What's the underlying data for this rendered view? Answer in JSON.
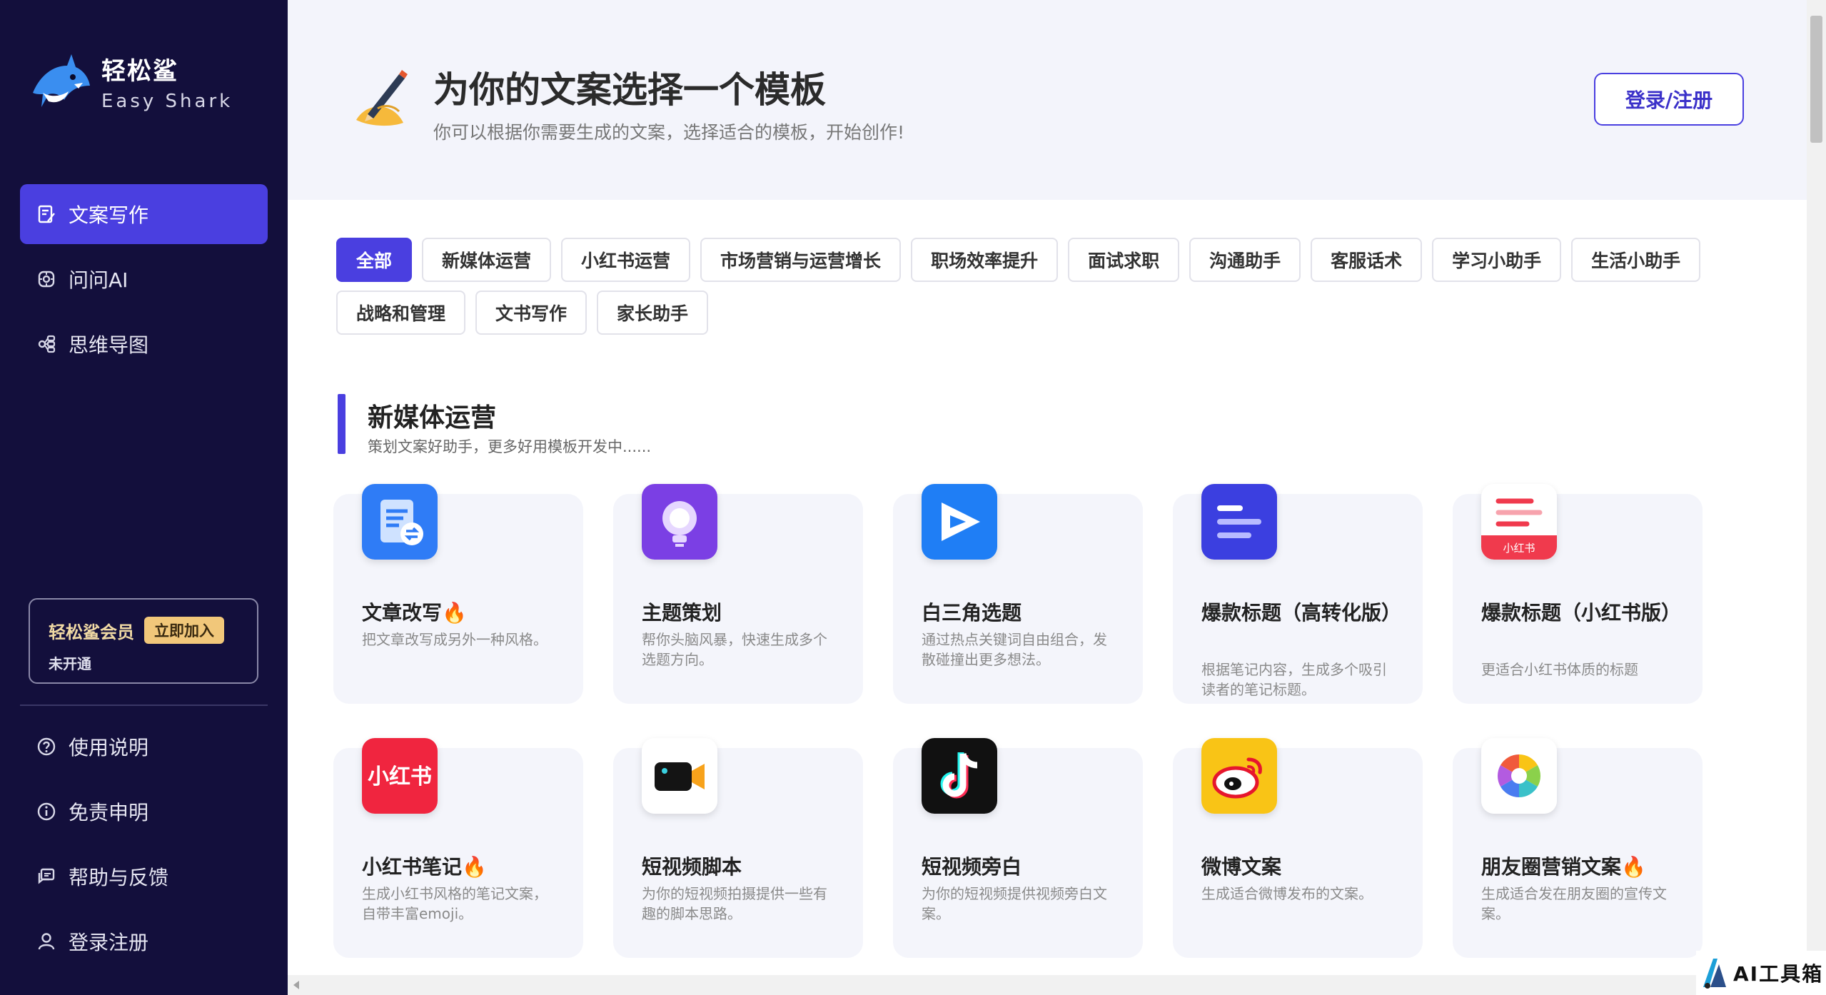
{
  "brand": {
    "name_cn": "轻松鲨",
    "name_en": "Easy Shark"
  },
  "sidebar": {
    "top_items": [
      {
        "label": "文案写作",
        "icon": "edit-doc-icon",
        "active": true
      },
      {
        "label": "问问AI",
        "icon": "ai-chat-icon",
        "active": false
      },
      {
        "label": "思维导图",
        "icon": "mindmap-icon",
        "active": false
      }
    ],
    "member": {
      "title": "轻松鲨会员",
      "join_label": "立即加入",
      "status": "未开通"
    },
    "bottom_items": [
      {
        "label": "使用说明",
        "icon": "help-circle-icon"
      },
      {
        "label": "免责申明",
        "icon": "info-circle-icon"
      },
      {
        "label": "帮助与反馈",
        "icon": "feedback-icon"
      },
      {
        "label": "登录注册",
        "icon": "user-icon"
      }
    ]
  },
  "header": {
    "emoji": "✍",
    "title": "为你的文案选择一个模板",
    "subtitle": "你可以根据你需要生成的文案，选择适合的模板，开始创作!",
    "login_label": "登录/注册"
  },
  "tabs": [
    "全部",
    "新媒体运营",
    "小红书运营",
    "市场营销与运营增长",
    "职场效率提升",
    "面试求职",
    "沟通助手",
    "客服话术",
    "学习小助手",
    "生活小助手",
    "战略和管理",
    "文书写作",
    "家长助手"
  ],
  "section": {
    "title": "新媒体运营",
    "subtitle": "策划文案好助手，更多好用模板开发中......"
  },
  "cards": [
    {
      "title": "文章改写🔥",
      "desc": "把文章改写成另外一种风格。",
      "icon": "article-rewrite-icon"
    },
    {
      "title": "主题策划",
      "desc": "帮你头脑风暴，快速生成多个选题方向。",
      "icon": "lightbulb-icon"
    },
    {
      "title": "白三角选题",
      "desc": "通过热点关键词自由组合，发散碰撞出更多想法。",
      "icon": "white-triangle-icon"
    },
    {
      "title": "爆款标题（高转化版）",
      "desc": "根据笔记内容，生成多个吸引读者的笔记标题。",
      "icon": "title-lines-icon"
    },
    {
      "title": "爆款标题（小红书版）",
      "desc": "更适合小红书体质的标题",
      "icon": "xiaohongshu-doc-icon",
      "icon_badge": "小红书"
    },
    {
      "title": "小红书笔记🔥",
      "desc": "生成小红书风格的笔记文案，自带丰富emoji。",
      "icon": "xiaohongshu-logo-icon",
      "icon_text": "小红书"
    },
    {
      "title": "短视频脚本",
      "desc": "为你的短视频拍摄提供一些有趣的脚本思路。",
      "icon": "video-camera-icon"
    },
    {
      "title": "短视频旁白",
      "desc": "为你的短视频提供视频旁白文案。",
      "icon": "tiktok-icon"
    },
    {
      "title": "微博文案",
      "desc": "生成适合微博发布的文案。",
      "icon": "weibo-icon"
    },
    {
      "title": "朋友圈营销文案🔥",
      "desc": "生成适合发在朋友圈的宣传文案。",
      "icon": "moments-icon"
    }
  ],
  "watermark": {
    "text": "AI工具箱"
  },
  "colors": {
    "sidebar_bg": "#130f3c",
    "accent": "#4a3fe0",
    "hero_bg": "#f3f4fb",
    "card_bg": "#f4f5fb"
  }
}
